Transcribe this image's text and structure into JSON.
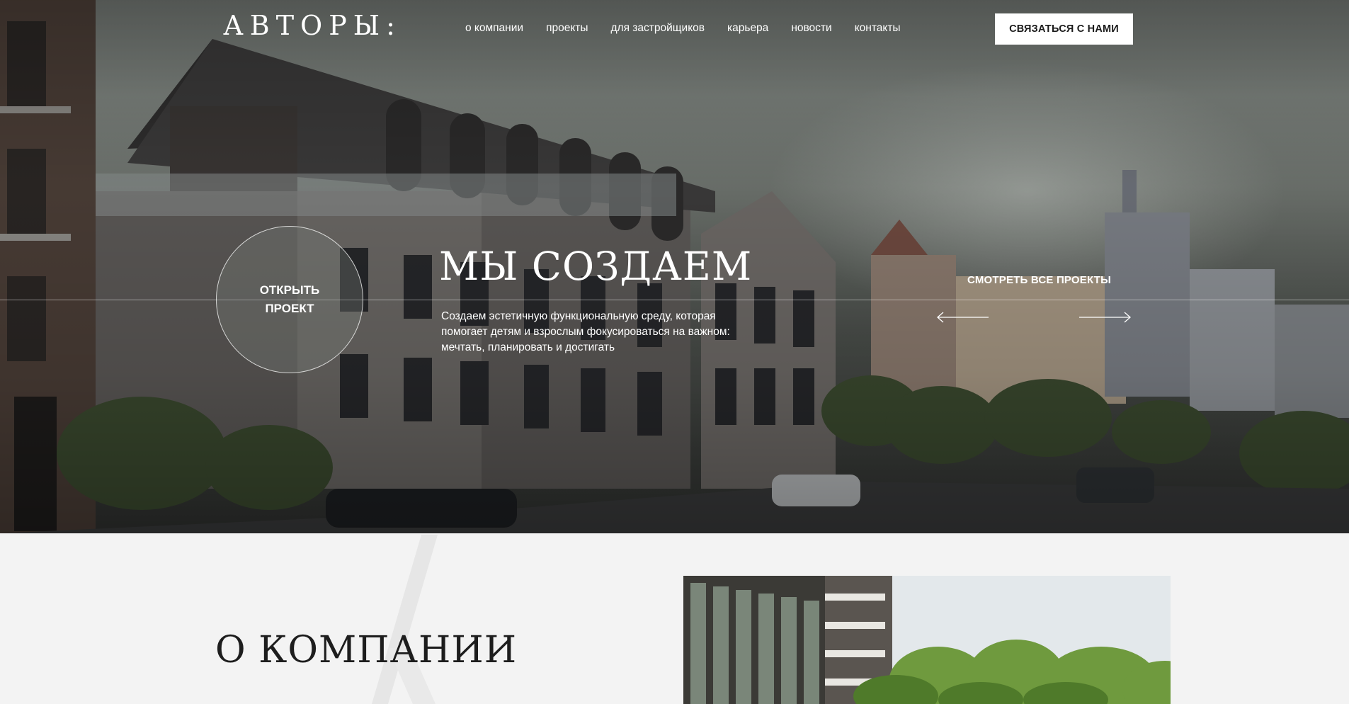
{
  "header": {
    "logo": "АВТОРЫ:",
    "nav": [
      "о компании",
      "проекты",
      "для застройщиков",
      "карьера",
      "новости",
      "контакты"
    ],
    "contact_button": "СВЯЗАТЬСЯ С НАМИ"
  },
  "hero": {
    "open_project": "ОТКРЫТЬ ПРОЕКТ",
    "title": "МЫ СОЗДАЕМ",
    "text": "Создаем эстетичную функциональную среду, которая помогает детям и взрослым фокусироваться на важном: мечтать, планировать и достигать",
    "all_projects": "СМОТРЕТЬ ВСЕ ПРОЕКТЫ",
    "icons": {
      "prev": "arrow-left-icon",
      "next": "arrow-right-icon"
    }
  },
  "about": {
    "title": "О КОМПАНИИ"
  },
  "colors": {
    "hero_overlay": "#3c3f3c",
    "text_light": "#ffffff",
    "page_bg": "#f3f3f3",
    "heading_dark": "#1d1d1d"
  }
}
